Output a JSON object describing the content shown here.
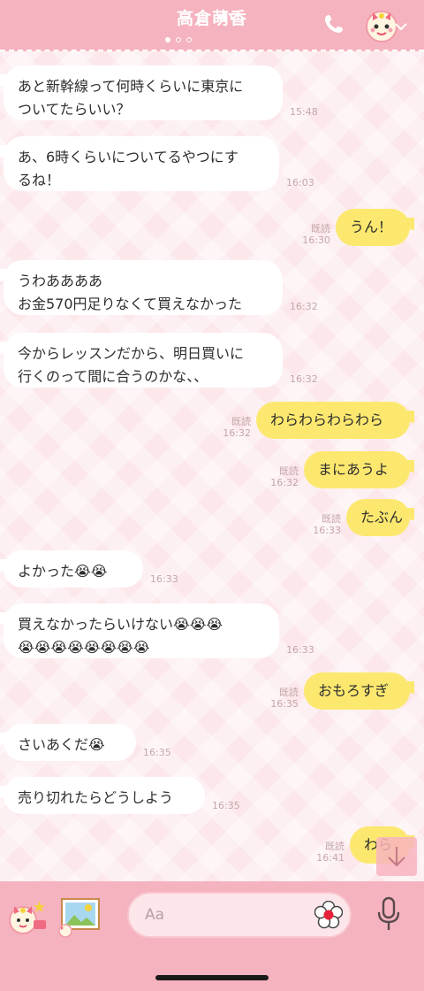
{
  "header": {
    "title": "高倉萌香",
    "icons": [
      "mute-icon",
      "phone-icon",
      "doll-avatar-icon",
      "chevron-down-icon"
    ]
  },
  "messages": [
    {
      "side": "in",
      "text": "あと新幹線って何時くらいに東京に\nついてたらいい？",
      "time": "15:48",
      "read": ""
    },
    {
      "side": "in",
      "text": "あ、6時くらいについてるやつにす\nるね！",
      "time": "16:03",
      "read": ""
    },
    {
      "side": "out",
      "text": "うん！",
      "time": "16:30",
      "read": "既読"
    },
    {
      "side": "in",
      "text": "うわああああ\nお金570円足りなくて買えなかった",
      "time": "16:32",
      "read": ""
    },
    {
      "side": "in",
      "text": "今からレッスンだから、明日買いに\n行くのって間に合うのかな、、",
      "time": "16:32",
      "read": ""
    },
    {
      "side": "out",
      "text": "わらわらわらわら",
      "time": "16:32",
      "read": "既読"
    },
    {
      "side": "out",
      "text": "まにあうよ",
      "time": "16:32",
      "read": "既読"
    },
    {
      "side": "out",
      "text": "たぶん",
      "time": "16:33",
      "read": "既読"
    },
    {
      "side": "in",
      "text": "よかった😭😭",
      "time": "16:33",
      "read": ""
    },
    {
      "side": "in",
      "text": "買えなかったらいけない😭😭😭\n😭😭😭😭😭😭😭😭",
      "time": "16:33",
      "read": ""
    },
    {
      "side": "out",
      "text": "おもろすぎ",
      "time": "16:35",
      "read": "既読"
    },
    {
      "side": "in",
      "text": "さいあくだ😭",
      "time": "16:35",
      "read": ""
    },
    {
      "side": "in",
      "text": "売り切れたらどうしよう",
      "time": "16:35",
      "read": ""
    },
    {
      "side": "out",
      "text": "わら",
      "time": "16:41",
      "read": "既読"
    }
  ],
  "input": {
    "placeholder": "Aa"
  },
  "colors": {
    "header": "#f5b3bf",
    "incoming_bubble": "#ffffff",
    "outgoing_bubble": "#fce86f",
    "meta_text": "#c4a6ab"
  }
}
